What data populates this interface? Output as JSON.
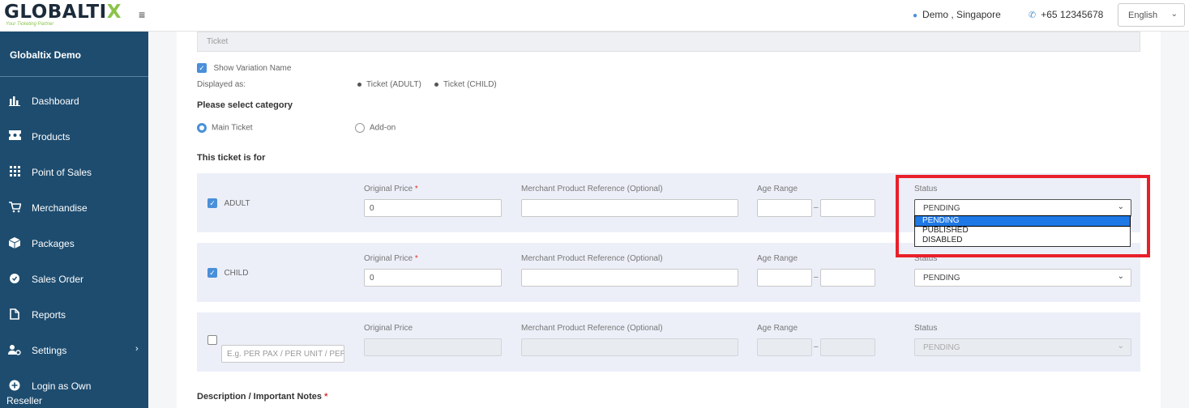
{
  "header": {
    "logo_text": "GLOBALTIX",
    "logo_tagline": "Your Ticketing Partner",
    "menu_icon": "hamburger-icon",
    "user_label": "Demo , Singapore",
    "phone_label": "+65 12345678",
    "language": "English"
  },
  "sidebar": {
    "brand": "Globaltix Demo",
    "items": [
      {
        "label": "Dashboard",
        "icon": "bar-chart-icon"
      },
      {
        "label": "Products",
        "icon": "ticket-icon"
      },
      {
        "label": "Point of Sales",
        "icon": "grid-icon"
      },
      {
        "label": "Merchandise",
        "icon": "cart-icon"
      },
      {
        "label": "Packages",
        "icon": "box-icon"
      },
      {
        "label": "Sales Order",
        "icon": "settings-badge-icon"
      },
      {
        "label": "Reports",
        "icon": "document-icon"
      },
      {
        "label": "Settings",
        "icon": "user-settings-icon"
      },
      {
        "label": "Login as Own",
        "label2": "Reseller",
        "icon": "plus-circle-icon"
      }
    ]
  },
  "form": {
    "ticket_name_value": "Ticket",
    "show_variation_label": "Show Variation Name",
    "displayed_as_label": "Displayed as:",
    "displayed_as_values": [
      "Ticket (ADULT)",
      "Ticket (CHILD)"
    ],
    "category_heading": "Please select category",
    "category_options": [
      "Main Ticket",
      "Add-on"
    ],
    "ticket_for_heading": "This ticket is for",
    "description_heading": "Description / Important Notes",
    "required_mark": "*"
  },
  "labels": {
    "original_price": "Original Price",
    "merchant_ref": "Merchant Product Reference (Optional)",
    "age_range": "Age Range",
    "status": "Status",
    "dash": "–"
  },
  "rows": [
    {
      "name": "ADULT",
      "checked": true,
      "price": "0",
      "status": "PENDING"
    },
    {
      "name": "CHILD",
      "checked": true,
      "price": "0",
      "status": "PENDING"
    },
    {
      "name": "",
      "placeholder": "E.g. PER PAX / PER UNIT / PER",
      "checked": false,
      "price": "",
      "status": "PENDING"
    }
  ],
  "status_options": [
    "PENDING",
    "PUBLISHED",
    "DISABLED"
  ],
  "colors": {
    "sidebar_bg": "#1d4c6f",
    "accent": "#4a8fd9",
    "highlight": "#e8202a",
    "row_bg": "#eceff8"
  }
}
